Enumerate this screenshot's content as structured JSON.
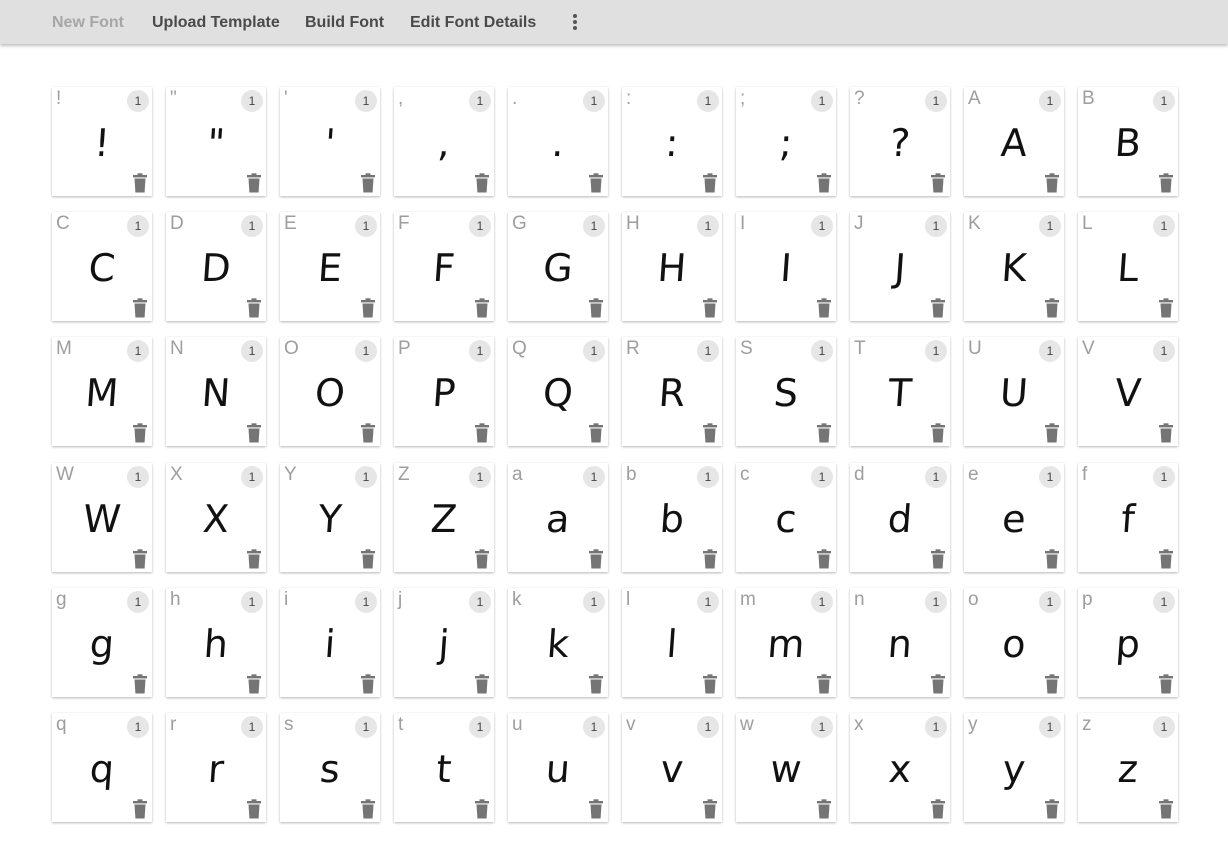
{
  "toolbar": {
    "items": [
      {
        "label": "New Font",
        "enabled": false
      },
      {
        "label": "Upload Template",
        "enabled": true
      },
      {
        "label": "Build Font",
        "enabled": true
      },
      {
        "label": "Edit Font Details",
        "enabled": true
      }
    ],
    "more_icon": "vertical-dots-icon"
  },
  "delete_icon": "trash-icon",
  "glyphs": [
    {
      "char": "!",
      "count": "1"
    },
    {
      "char": "\"",
      "count": "1"
    },
    {
      "char": "'",
      "count": "1"
    },
    {
      "char": ",",
      "count": "1"
    },
    {
      "char": ".",
      "count": "1"
    },
    {
      "char": ":",
      "count": "1"
    },
    {
      "char": ";",
      "count": "1"
    },
    {
      "char": "?",
      "count": "1"
    },
    {
      "char": "A",
      "count": "1"
    },
    {
      "char": "B",
      "count": "1"
    },
    {
      "char": "C",
      "count": "1"
    },
    {
      "char": "D",
      "count": "1"
    },
    {
      "char": "E",
      "count": "1"
    },
    {
      "char": "F",
      "count": "1"
    },
    {
      "char": "G",
      "count": "1"
    },
    {
      "char": "H",
      "count": "1"
    },
    {
      "char": "I",
      "count": "1"
    },
    {
      "char": "J",
      "count": "1"
    },
    {
      "char": "K",
      "count": "1"
    },
    {
      "char": "L",
      "count": "1"
    },
    {
      "char": "M",
      "count": "1"
    },
    {
      "char": "N",
      "count": "1"
    },
    {
      "char": "O",
      "count": "1"
    },
    {
      "char": "P",
      "count": "1"
    },
    {
      "char": "Q",
      "count": "1"
    },
    {
      "char": "R",
      "count": "1"
    },
    {
      "char": "S",
      "count": "1"
    },
    {
      "char": "T",
      "count": "1"
    },
    {
      "char": "U",
      "count": "1"
    },
    {
      "char": "V",
      "count": "1"
    },
    {
      "char": "W",
      "count": "1"
    },
    {
      "char": "X",
      "count": "1"
    },
    {
      "char": "Y",
      "count": "1"
    },
    {
      "char": "Z",
      "count": "1"
    },
    {
      "char": "a",
      "count": "1"
    },
    {
      "char": "b",
      "count": "1"
    },
    {
      "char": "c",
      "count": "1"
    },
    {
      "char": "d",
      "count": "1"
    },
    {
      "char": "e",
      "count": "1"
    },
    {
      "char": "f",
      "count": "1"
    },
    {
      "char": "g",
      "count": "1"
    },
    {
      "char": "h",
      "count": "1"
    },
    {
      "char": "i",
      "count": "1"
    },
    {
      "char": "j",
      "count": "1"
    },
    {
      "char": "k",
      "count": "1"
    },
    {
      "char": "l",
      "count": "1"
    },
    {
      "char": "m",
      "count": "1"
    },
    {
      "char": "n",
      "count": "1"
    },
    {
      "char": "o",
      "count": "1"
    },
    {
      "char": "p",
      "count": "1"
    },
    {
      "char": "q",
      "count": "1"
    },
    {
      "char": "r",
      "count": "1"
    },
    {
      "char": "s",
      "count": "1"
    },
    {
      "char": "t",
      "count": "1"
    },
    {
      "char": "u",
      "count": "1"
    },
    {
      "char": "v",
      "count": "1"
    },
    {
      "char": "w",
      "count": "1"
    },
    {
      "char": "x",
      "count": "1"
    },
    {
      "char": "y",
      "count": "1"
    },
    {
      "char": "z",
      "count": "1"
    }
  ]
}
